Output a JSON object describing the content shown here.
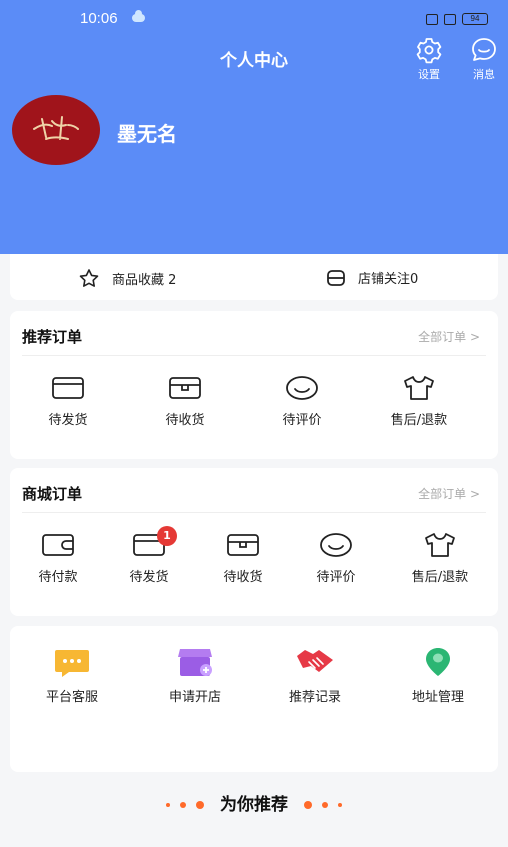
{
  "status_bar": {
    "time": "10:06",
    "battery": "94"
  },
  "header": {
    "title": "个人中心",
    "settings_label": "设置",
    "messages_label": "消息",
    "username": "墨无名"
  },
  "favorites": {
    "goods_label": "商品收藏 2",
    "shops_label": "店铺关注0"
  },
  "recommend_orders": {
    "title": "推荐订单",
    "all_link": "全部订单 >",
    "items": [
      {
        "label": "待发货",
        "icon": "card-icon"
      },
      {
        "label": "待收货",
        "icon": "box-icon"
      },
      {
        "label": "待评价",
        "icon": "smile-icon"
      },
      {
        "label": "售后/退款",
        "icon": "shirt-icon"
      }
    ]
  },
  "mall_orders": {
    "title": "商城订单",
    "all_link": "全部订单 >",
    "items": [
      {
        "label": "待付款",
        "icon": "wallet-icon"
      },
      {
        "label": "待发货",
        "icon": "card-icon",
        "badge": "1"
      },
      {
        "label": "待收货",
        "icon": "box-icon"
      },
      {
        "label": "待评价",
        "icon": "smile-icon"
      },
      {
        "label": "售后/退款",
        "icon": "shirt-icon"
      }
    ]
  },
  "services": {
    "items": [
      {
        "label": "平台客服",
        "icon": "chat-icon",
        "color": "#f7b733"
      },
      {
        "label": "申请开店",
        "icon": "store-icon",
        "color": "#9b5de5"
      },
      {
        "label": "推荐记录",
        "icon": "handshake-icon",
        "color": "#e63946"
      },
      {
        "label": "地址管理",
        "icon": "location-icon",
        "color": "#2bb673"
      }
    ]
  },
  "recommend_title": "为你推荐",
  "colors": {
    "header": "#5b8cf7",
    "badge": "#e53935",
    "accent": "#ff6a2a"
  }
}
